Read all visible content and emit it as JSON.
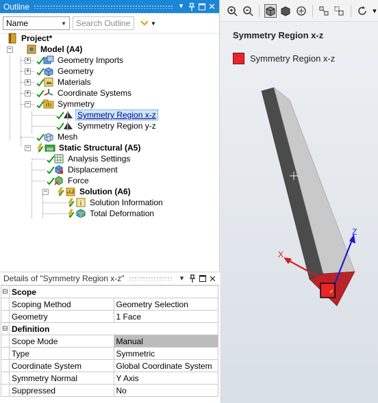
{
  "outline": {
    "title": "Outline",
    "filter_label": "Name",
    "search_placeholder": "Search Outline",
    "tree": {
      "project": "Project*",
      "model": "Model (A4)",
      "geometry_imports": "Geometry Imports",
      "geometry": "Geometry",
      "materials": "Materials",
      "coordinate_systems": "Coordinate Systems",
      "symmetry": "Symmetry",
      "symmetry_xz": "Symmetry Region x-z",
      "symmetry_yz": "Symmetry Region y-z",
      "mesh": "Mesh",
      "static_structural": "Static Structural (A5)",
      "analysis_settings": "Analysis Settings",
      "displacement": "Displacement",
      "force": "Force",
      "solution": "Solution (A6)",
      "solution_information": "Solution Information",
      "total_deformation": "Total Deformation"
    }
  },
  "details": {
    "title": "Details of \"Symmetry Region x-z\"",
    "groups": {
      "scope": "Scope",
      "definition": "Definition"
    },
    "rows": {
      "scoping_method": {
        "name": "Scoping Method",
        "value": "Geometry Selection"
      },
      "geometry": {
        "name": "Geometry",
        "value": "1 Face"
      },
      "scope_mode": {
        "name": "Scope Mode",
        "value": "Manual"
      },
      "type": {
        "name": "Type",
        "value": "Symmetric"
      },
      "coordinate_system": {
        "name": "Coordinate System",
        "value": "Global Coordinate System"
      },
      "symmetry_normal": {
        "name": "Symmetry Normal",
        "value": "Y Axis"
      },
      "suppressed": {
        "name": "Suppressed",
        "value": "No"
      }
    }
  },
  "viewport": {
    "title": "Symmetry Region x-z",
    "legend_label": "Symmetry Region x-z",
    "legend_color": "#e8242c",
    "axes": {
      "x": "X",
      "z": "Z"
    },
    "colors": {
      "accent": "#1c86d6",
      "x_axis": "#d21d1d",
      "z_axis": "#1c1ccf",
      "face": "#c0272d"
    }
  }
}
